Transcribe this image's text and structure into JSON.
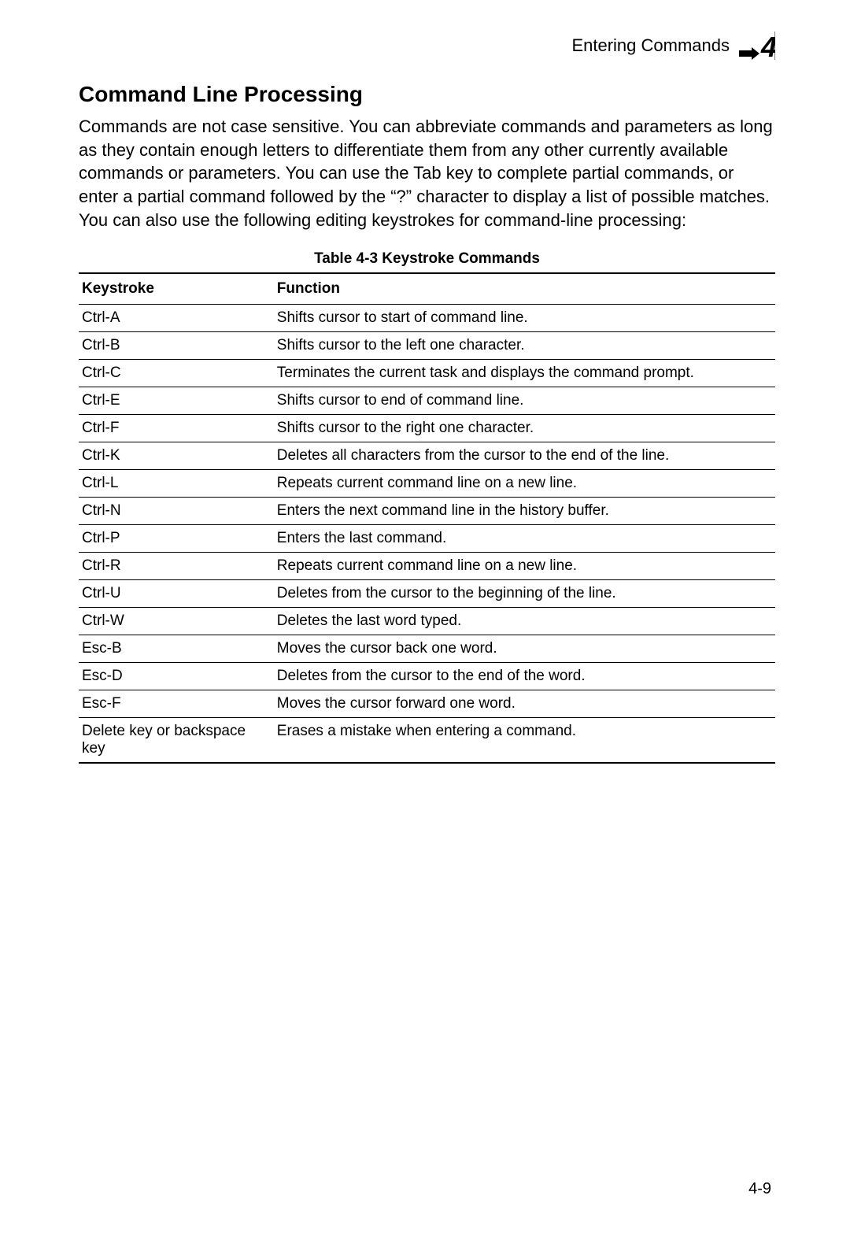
{
  "header": {
    "label": "Entering Commands",
    "chapter_number": "4"
  },
  "section": {
    "heading": "Command Line Processing",
    "paragraph": "Commands are not case sensitive. You can abbreviate commands and parameters as long as they contain enough letters to differentiate them from any other currently available commands or parameters. You can use the Tab key to complete partial commands, or enter a partial command followed by the “?” character to display a list of possible matches. You can also use the following editing keystrokes for command-line processing:"
  },
  "table": {
    "caption": "Table 4-3   Keystroke Commands",
    "columns": [
      "Keystroke",
      "Function"
    ],
    "rows": [
      {
        "key": "Ctrl-A",
        "func": "Shifts cursor to start of command line."
      },
      {
        "key": "Ctrl-B",
        "func": "Shifts cursor to the left one character."
      },
      {
        "key": "Ctrl-C",
        "func": "Terminates the current task and displays the command prompt."
      },
      {
        "key": "Ctrl-E",
        "func": "Shifts cursor to end of command line."
      },
      {
        "key": "Ctrl-F",
        "func": "Shifts cursor to the right one character."
      },
      {
        "key": "Ctrl-K",
        "func": "Deletes all characters from the cursor to the end of the line."
      },
      {
        "key": "Ctrl-L",
        "func": "Repeats current command line on a new line."
      },
      {
        "key": "Ctrl-N",
        "func": "Enters the next command line in the history buffer."
      },
      {
        "key": "Ctrl-P",
        "func": "Enters the last command."
      },
      {
        "key": "Ctrl-R",
        "func": "Repeats current command line on a new line."
      },
      {
        "key": "Ctrl-U",
        "func": "Deletes from the cursor to the beginning of the line."
      },
      {
        "key": "Ctrl-W",
        "func": "Deletes the last word typed."
      },
      {
        "key": "Esc-B",
        "func": "Moves the cursor back one word."
      },
      {
        "key": "Esc-D",
        "func": "Deletes from the cursor to the end of the word."
      },
      {
        "key": "Esc-F",
        "func": "Moves the cursor forward one word."
      },
      {
        "key": "Delete key or backspace key",
        "func": "Erases a mistake when entering a command."
      }
    ]
  },
  "footer": {
    "page_number": "4-9"
  }
}
